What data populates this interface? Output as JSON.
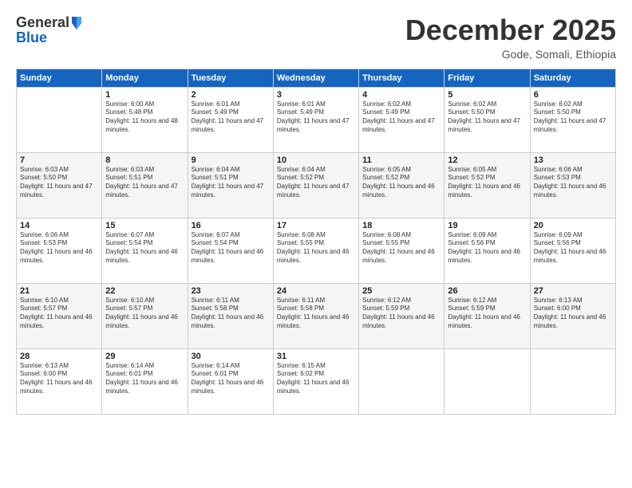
{
  "logo": {
    "general": "General",
    "blue": "Blue"
  },
  "title": "December 2025",
  "subtitle": "Gode, Somali, Ethiopia",
  "days_of_week": [
    "Sunday",
    "Monday",
    "Tuesday",
    "Wednesday",
    "Thursday",
    "Friday",
    "Saturday"
  ],
  "weeks": [
    [
      {
        "day": "",
        "sunrise": "",
        "sunset": "",
        "daylight": ""
      },
      {
        "day": "1",
        "sunrise": "Sunrise: 6:00 AM",
        "sunset": "Sunset: 5:48 PM",
        "daylight": "Daylight: 11 hours and 48 minutes."
      },
      {
        "day": "2",
        "sunrise": "Sunrise: 6:01 AM",
        "sunset": "Sunset: 5:49 PM",
        "daylight": "Daylight: 11 hours and 47 minutes."
      },
      {
        "day": "3",
        "sunrise": "Sunrise: 6:01 AM",
        "sunset": "Sunset: 5:49 PM",
        "daylight": "Daylight: 11 hours and 47 minutes."
      },
      {
        "day": "4",
        "sunrise": "Sunrise: 6:02 AM",
        "sunset": "Sunset: 5:49 PM",
        "daylight": "Daylight: 11 hours and 47 minutes."
      },
      {
        "day": "5",
        "sunrise": "Sunrise: 6:02 AM",
        "sunset": "Sunset: 5:50 PM",
        "daylight": "Daylight: 11 hours and 47 minutes."
      },
      {
        "day": "6",
        "sunrise": "Sunrise: 6:02 AM",
        "sunset": "Sunset: 5:50 PM",
        "daylight": "Daylight: 11 hours and 47 minutes."
      }
    ],
    [
      {
        "day": "7",
        "sunrise": "Sunrise: 6:03 AM",
        "sunset": "Sunset: 5:50 PM",
        "daylight": "Daylight: 11 hours and 47 minutes."
      },
      {
        "day": "8",
        "sunrise": "Sunrise: 6:03 AM",
        "sunset": "Sunset: 5:51 PM",
        "daylight": "Daylight: 11 hours and 47 minutes."
      },
      {
        "day": "9",
        "sunrise": "Sunrise: 6:04 AM",
        "sunset": "Sunset: 5:51 PM",
        "daylight": "Daylight: 11 hours and 47 minutes."
      },
      {
        "day": "10",
        "sunrise": "Sunrise: 6:04 AM",
        "sunset": "Sunset: 5:52 PM",
        "daylight": "Daylight: 11 hours and 47 minutes."
      },
      {
        "day": "11",
        "sunrise": "Sunrise: 6:05 AM",
        "sunset": "Sunset: 5:52 PM",
        "daylight": "Daylight: 11 hours and 46 minutes."
      },
      {
        "day": "12",
        "sunrise": "Sunrise: 6:05 AM",
        "sunset": "Sunset: 5:52 PM",
        "daylight": "Daylight: 11 hours and 46 minutes."
      },
      {
        "day": "13",
        "sunrise": "Sunrise: 6:06 AM",
        "sunset": "Sunset: 5:53 PM",
        "daylight": "Daylight: 11 hours and 46 minutes."
      }
    ],
    [
      {
        "day": "14",
        "sunrise": "Sunrise: 6:06 AM",
        "sunset": "Sunset: 5:53 PM",
        "daylight": "Daylight: 11 hours and 46 minutes."
      },
      {
        "day": "15",
        "sunrise": "Sunrise: 6:07 AM",
        "sunset": "Sunset: 5:54 PM",
        "daylight": "Daylight: 11 hours and 46 minutes."
      },
      {
        "day": "16",
        "sunrise": "Sunrise: 6:07 AM",
        "sunset": "Sunset: 5:54 PM",
        "daylight": "Daylight: 11 hours and 46 minutes."
      },
      {
        "day": "17",
        "sunrise": "Sunrise: 6:08 AM",
        "sunset": "Sunset: 5:55 PM",
        "daylight": "Daylight: 11 hours and 46 minutes."
      },
      {
        "day": "18",
        "sunrise": "Sunrise: 6:08 AM",
        "sunset": "Sunset: 5:55 PM",
        "daylight": "Daylight: 11 hours and 46 minutes."
      },
      {
        "day": "19",
        "sunrise": "Sunrise: 6:09 AM",
        "sunset": "Sunset: 5:56 PM",
        "daylight": "Daylight: 11 hours and 46 minutes."
      },
      {
        "day": "20",
        "sunrise": "Sunrise: 6:09 AM",
        "sunset": "Sunset: 5:56 PM",
        "daylight": "Daylight: 11 hours and 46 minutes."
      }
    ],
    [
      {
        "day": "21",
        "sunrise": "Sunrise: 6:10 AM",
        "sunset": "Sunset: 5:57 PM",
        "daylight": "Daylight: 11 hours and 46 minutes."
      },
      {
        "day": "22",
        "sunrise": "Sunrise: 6:10 AM",
        "sunset": "Sunset: 5:57 PM",
        "daylight": "Daylight: 11 hours and 46 minutes."
      },
      {
        "day": "23",
        "sunrise": "Sunrise: 6:11 AM",
        "sunset": "Sunset: 5:58 PM",
        "daylight": "Daylight: 11 hours and 46 minutes."
      },
      {
        "day": "24",
        "sunrise": "Sunrise: 6:11 AM",
        "sunset": "Sunset: 5:58 PM",
        "daylight": "Daylight: 11 hours and 46 minutes."
      },
      {
        "day": "25",
        "sunrise": "Sunrise: 6:12 AM",
        "sunset": "Sunset: 5:59 PM",
        "daylight": "Daylight: 11 hours and 46 minutes."
      },
      {
        "day": "26",
        "sunrise": "Sunrise: 6:12 AM",
        "sunset": "Sunset: 5:59 PM",
        "daylight": "Daylight: 11 hours and 46 minutes."
      },
      {
        "day": "27",
        "sunrise": "Sunrise: 6:13 AM",
        "sunset": "Sunset: 6:00 PM",
        "daylight": "Daylight: 11 hours and 46 minutes."
      }
    ],
    [
      {
        "day": "28",
        "sunrise": "Sunrise: 6:13 AM",
        "sunset": "Sunset: 6:00 PM",
        "daylight": "Daylight: 11 hours and 46 minutes."
      },
      {
        "day": "29",
        "sunrise": "Sunrise: 6:14 AM",
        "sunset": "Sunset: 6:01 PM",
        "daylight": "Daylight: 11 hours and 46 minutes."
      },
      {
        "day": "30",
        "sunrise": "Sunrise: 6:14 AM",
        "sunset": "Sunset: 6:01 PM",
        "daylight": "Daylight: 11 hours and 46 minutes."
      },
      {
        "day": "31",
        "sunrise": "Sunrise: 6:15 AM",
        "sunset": "Sunset: 6:02 PM",
        "daylight": "Daylight: 11 hours and 46 minutes."
      },
      {
        "day": "",
        "sunrise": "",
        "sunset": "",
        "daylight": ""
      },
      {
        "day": "",
        "sunrise": "",
        "sunset": "",
        "daylight": ""
      },
      {
        "day": "",
        "sunrise": "",
        "sunset": "",
        "daylight": ""
      }
    ]
  ]
}
